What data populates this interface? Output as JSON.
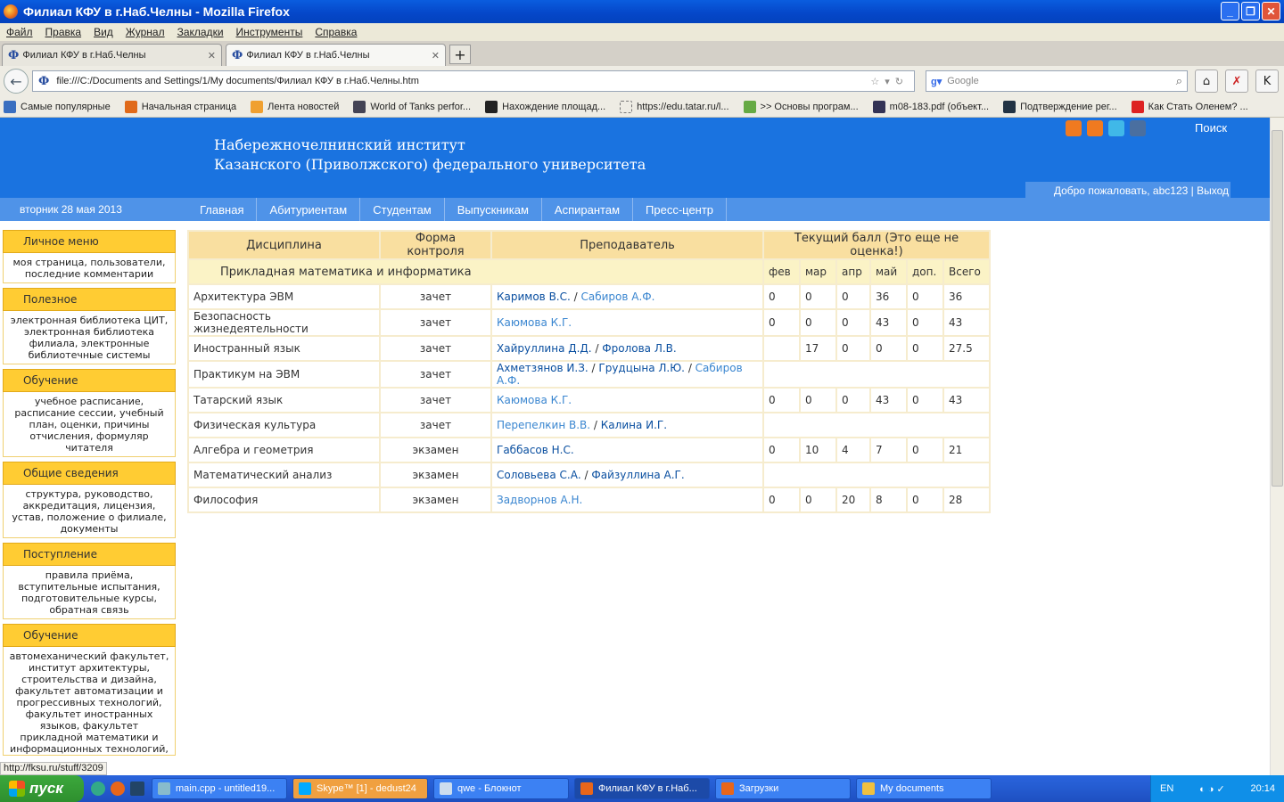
{
  "window": {
    "title": "Филиал КФУ в г.Наб.Челны - Mozilla Firefox"
  },
  "menu": [
    "Файл",
    "Правка",
    "Вид",
    "Журнал",
    "Закладки",
    "Инструменты",
    "Справка"
  ],
  "tabs": [
    {
      "label": "Филиал КФУ в г.Наб.Челны"
    },
    {
      "label": "Филиал КФУ в г.Наб.Челны"
    }
  ],
  "address": {
    "url": "file:///C:/Documents and Settings/1/My documents/Филиал КФУ в г.Наб.Челны.htm"
  },
  "search": {
    "placeholder": "Google"
  },
  "bookmarks": [
    {
      "label": "Самые популярные",
      "color": "#3a6fc0"
    },
    {
      "label": "Начальная страница",
      "color": "#e06a1a"
    },
    {
      "label": "Лента новостей",
      "color": "#f0a030"
    },
    {
      "label": "World of Tanks perfor...",
      "color": "#445"
    },
    {
      "label": "Нахождение площад...",
      "color": "#222"
    },
    {
      "label": "https://edu.tatar.ru/l...",
      "color": "#ffffff"
    },
    {
      "label": ">> Основы програм...",
      "color": "#6a4"
    },
    {
      "label": "m08-183.pdf (объект...",
      "color": "#335"
    },
    {
      "label": "Подтверждение рег...",
      "color": "#234"
    },
    {
      "label": "Как Стать Оленем? ...",
      "color": "#d22"
    }
  ],
  "site": {
    "institute_line1": "Набережночелнинский институт",
    "institute_line2": "Казанского (Приволжского) федерального университета",
    "search_link": "Поиск",
    "welcome": "Добро пожаловать, abc123 | Выход",
    "date": "вторник 28 мая 2013",
    "nav": [
      "Главная",
      "Абитуриентам",
      "Студентам",
      "Выпускникам",
      "Аспирантам",
      "Пресс-центр"
    ]
  },
  "sidebar": [
    {
      "title": "Личное меню",
      "body": "моя страница, пользователи, последние комментарии"
    },
    {
      "title": "Полезное",
      "body": "электронная библиотека ЦИТ, электронная библиотека филиала, электронные библиотечные системы"
    },
    {
      "title": "Обучение",
      "body": "учебное расписание, расписание сессии, учебный план, оценки, причины отчисления, формуляр читателя"
    },
    {
      "title": "Общие сведения",
      "body": "структура, руководство, аккредитация, лицензия, устав, положение о филиале, документы"
    },
    {
      "title": "Поступление",
      "body": "правила приёма, вступительные испытания, подготовительные курсы, обратная связь"
    },
    {
      "title": "Обучение",
      "body": "автомеханический факультет, институт архитектуры, строительства и дизайна, факультет автоматизации и прогрессивных технологий, факультет иностранных языков, факультет прикладной математики и информационных технологий, ... технологии и ... экономический"
    }
  ],
  "grades": {
    "headers": {
      "discipline": "Дисциплина",
      "control": "Форма контроля",
      "teacher": "Преподаватель",
      "score": "Текущий балл (Это еще не оценка!)"
    },
    "program": "Прикладная математика и информатика",
    "months": [
      "фев",
      "мар",
      "апр",
      "май",
      "доп.",
      "Всего"
    ],
    "rows": [
      {
        "discipline": "Архитектура ЭВМ",
        "control": "зачет",
        "teachers": [
          {
            "name": "Каримов В.С.",
            "light": false
          },
          {
            "name": "Сабиров А.Ф.",
            "light": true
          }
        ],
        "scores": [
          "0",
          "0",
          "0",
          "36",
          "0",
          "36"
        ]
      },
      {
        "discipline": "Безопасность жизнедеятельности",
        "control": "зачет",
        "teachers": [
          {
            "name": "Каюмова К.Г.",
            "light": true
          }
        ],
        "scores": [
          "0",
          "0",
          "0",
          "43",
          "0",
          "43"
        ]
      },
      {
        "discipline": "Иностранный язык",
        "control": "зачет",
        "teachers": [
          {
            "name": "Хайруллина Д.Д.",
            "light": false
          },
          {
            "name": "Фролова Л.В.",
            "light": false
          }
        ],
        "scores": [
          "",
          "17",
          "0",
          "0",
          "0",
          "27.5"
        ]
      },
      {
        "discipline": "Практикум на ЭВМ",
        "control": "зачет",
        "teachers": [
          {
            "name": "Ахметзянов И.З.",
            "light": false
          },
          {
            "name": "Грудцына Л.Ю.",
            "light": false
          },
          {
            "name": "Сабиров А.Ф.",
            "light": true
          }
        ],
        "scores": null
      },
      {
        "discipline": "Татарский язык",
        "control": "зачет",
        "teachers": [
          {
            "name": "Каюмова К.Г.",
            "light": true
          }
        ],
        "scores": [
          "0",
          "0",
          "0",
          "43",
          "0",
          "43"
        ]
      },
      {
        "discipline": "Физическая культура",
        "control": "зачет",
        "teachers": [
          {
            "name": "Перепелкин В.В.",
            "light": true
          },
          {
            "name": "Калина И.Г.",
            "light": false
          }
        ],
        "scores": null
      },
      {
        "discipline": "Алгебра и геометрия",
        "control": "экзамен",
        "teachers": [
          {
            "name": "Габбасов Н.С.",
            "light": false
          }
        ],
        "scores": [
          "0",
          "10",
          "4",
          "7",
          "0",
          "21"
        ]
      },
      {
        "discipline": "Математический анализ",
        "control": "экзамен",
        "teachers": [
          {
            "name": "Соловьева С.А.",
            "light": false
          },
          {
            "name": "Файзуллина А.Г.",
            "light": false
          }
        ],
        "scores": null
      },
      {
        "discipline": "Философия",
        "control": "экзамен",
        "teachers": [
          {
            "name": "Задворнов А.Н.",
            "light": true
          }
        ],
        "scores": [
          "0",
          "0",
          "20",
          "8",
          "0",
          "28"
        ]
      }
    ]
  },
  "status": {
    "text": "http://fksu.ru/stuff/3209"
  },
  "taskbar": {
    "start": "пуск",
    "buttons": [
      {
        "label": "main.cpp - untitled19...",
        "color": "#8bc",
        "style": ""
      },
      {
        "label": "Skype™ [1] - dedust24",
        "color": "#0af",
        "style": "orange"
      },
      {
        "label": "qwe - Блокнот",
        "color": "#cde",
        "style": ""
      },
      {
        "label": "Филиал КФУ в г.Наб...",
        "color": "#e8661a",
        "style": "active"
      },
      {
        "label": "Загрузки",
        "color": "#e8661a",
        "style": ""
      },
      {
        "label": "My documents",
        "color": "#f0c040",
        "style": ""
      }
    ],
    "lang": "EN",
    "time": "20:14"
  }
}
